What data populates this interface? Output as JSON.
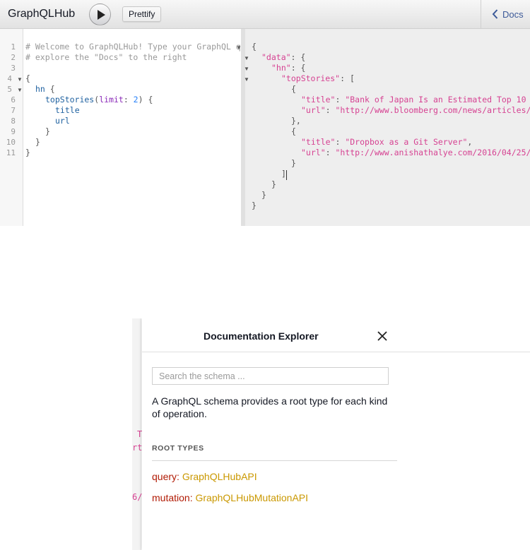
{
  "toolbar": {
    "title": "GraphQLHub",
    "prettify_label": "Prettify",
    "docs_label": "Docs"
  },
  "query_editor": {
    "line_numbers": [
      "1",
      "2",
      "3",
      "4",
      "5",
      "6",
      "7",
      "8",
      "9",
      "10",
      "11"
    ],
    "lines": {
      "l1": "# Welcome to GraphQLHub! Type your GraphQL q",
      "l2": "# explore the \"Docs\" to the right",
      "l4_brace": "{",
      "l5_field": "hn",
      "l5_brace": " {",
      "l6_field": "topStories",
      "l6_paren_open": "(",
      "l6_arg": "limit",
      "l6_colon": ": ",
      "l6_num": "2",
      "l6_close": ") {",
      "l7_field": "title",
      "l8_field": "url",
      "l9_brace": "}",
      "l10_brace": "}",
      "l11_brace": "}"
    }
  },
  "result_viewer": {
    "r1": "{",
    "r2_key": "\"data\"",
    "r2_rest": ": {",
    "r3_key": "\"hn\"",
    "r3_rest": ": {",
    "r4_key": "\"topStories\"",
    "r4_rest": ": [",
    "r5": "{",
    "r6_key": "\"title\"",
    "r6_sep": ": ",
    "r6_val": "\"Bank of Japan Is an Estimated Top 10",
    "r7_key": "\"url\"",
    "r7_sep": ": ",
    "r7_val": "\"http://www.bloomberg.com/news/articles/",
    "r8": "},",
    "r9": "{",
    "r10_key": "\"title\"",
    "r10_sep": ": ",
    "r10_val": "\"Dropbox as a Git Server\"",
    "r10_comma": ",",
    "r11_key": "\"url\"",
    "r11_sep": ": ",
    "r11_val": "\"http://www.anishathalye.com/2016/04/25/",
    "r12": "}",
    "r13": "]",
    "r14": "}",
    "r15": "}",
    "r16": "}"
  },
  "doc_explorer": {
    "edge_fragments": [
      "T",
      "rt",
      "6/"
    ],
    "title": "Documentation Explorer",
    "search_placeholder": "Search the schema ...",
    "description": "A GraphQL schema provides a root type for each kind of operation.",
    "root_types_header": "ROOT TYPES",
    "root_types": [
      {
        "field": "query",
        "sep": ": ",
        "type": "GraphQLHubAPI"
      },
      {
        "field": "mutation",
        "sep": ": ",
        "type": "GraphQLHubMutationAPI"
      }
    ]
  },
  "colors": {
    "string": "#d64292",
    "keyword_field": "#1f61a0",
    "argument": "#8b2bb9",
    "number": "#2882f9",
    "comment": "#999999",
    "doc_field": "#b11a04",
    "doc_type": "#ca9800",
    "link": "#3b5998"
  },
  "icons": [
    "play-icon",
    "chevron-left-icon",
    "close-icon",
    "fold-arrow-icon"
  ]
}
